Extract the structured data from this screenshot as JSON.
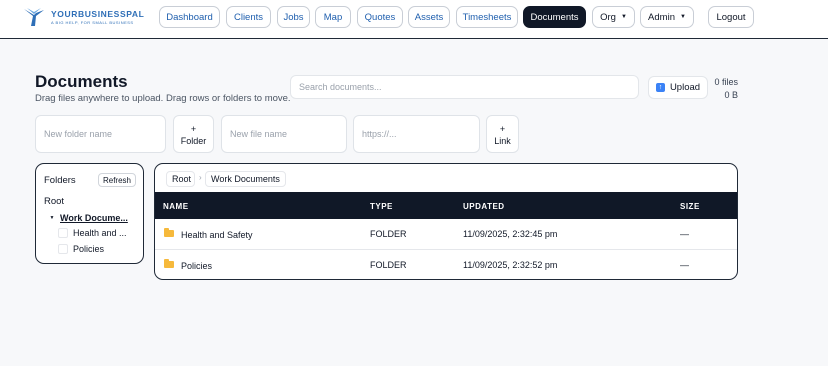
{
  "brand": {
    "name": "YOURBUSINESSPAL",
    "tagline": "A BIG HELP, FOR SMALL BUSINESS"
  },
  "nav": {
    "items": [
      "Dashboard",
      "Clients",
      "Jobs",
      "Map",
      "Quotes",
      "Assets",
      "Timesheets",
      "Documents"
    ],
    "active": "Documents",
    "org_label": "Org",
    "admin_label": "Admin",
    "logout_label": "Logout"
  },
  "page": {
    "title": "Documents",
    "subtitle": "Drag files anywhere to upload. Drag rows or folders to move.",
    "search_placeholder": "Search documents...",
    "upload_label": "Upload",
    "file_count": "0 files",
    "total_size": "0 B"
  },
  "create": {
    "folder_placeholder": "New folder name",
    "folder_button": [
      "+",
      "Folder"
    ],
    "file_placeholder": "New file name",
    "url_placeholder": "https://...",
    "link_button": [
      "+",
      "Link"
    ]
  },
  "folders_panel": {
    "title": "Folders",
    "refresh_label": "Refresh",
    "root_label": "Root",
    "tree": [
      {
        "label": "Work Docume...",
        "selected": true,
        "expanded": true
      },
      {
        "label": "Health and ..."
      },
      {
        "label": "Policies"
      }
    ]
  },
  "breadcrumb": [
    "Root",
    "Work Documents"
  ],
  "table": {
    "columns": [
      "NAME",
      "TYPE",
      "UPDATED",
      "SIZE"
    ],
    "rows": [
      {
        "name": "Health and Safety",
        "type": "FOLDER",
        "updated": "11/09/2025, 2:32:45 pm",
        "size": "—"
      },
      {
        "name": "Policies",
        "type": "FOLDER",
        "updated": "11/09/2025, 2:32:52 pm",
        "size": "—"
      }
    ]
  },
  "colors": {
    "brand_blue": "#2f6fb7",
    "active_nav": "#101827",
    "folder": "#f6b93b",
    "upload_icon": "#3b82f6"
  }
}
